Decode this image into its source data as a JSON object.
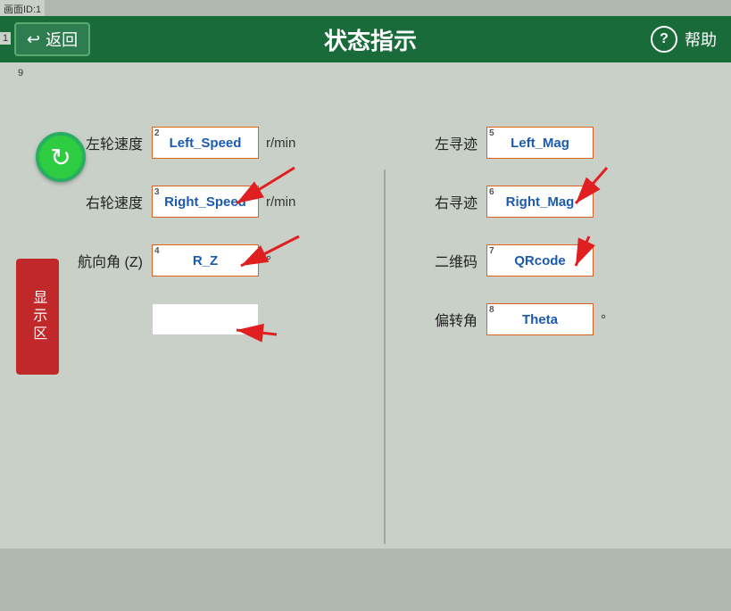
{
  "window": {
    "screen_id": "画面ID:1",
    "num_badge": "1"
  },
  "header": {
    "back_label": "返回",
    "title": "状态指示",
    "help_label": "帮助"
  },
  "clock_badge": "9",
  "left_section": {
    "rows": [
      {
        "num": "2",
        "label": "左轮速度",
        "value": "Left_Speed",
        "unit": "r/min"
      },
      {
        "num": "3",
        "label": "右轮速度",
        "value": "Right_Speed",
        "unit": "r/min"
      },
      {
        "num": "4",
        "label": "航向角 (Z)",
        "value": "R_Z",
        "unit": "°"
      },
      {
        "num": "",
        "label": "",
        "value": "",
        "unit": "",
        "empty": true
      }
    ]
  },
  "right_section": {
    "rows": [
      {
        "num": "5",
        "label": "左寻迹",
        "value": "Left_Mag",
        "unit": ""
      },
      {
        "num": "6",
        "label": "右寻迹",
        "value": "Right_Mag",
        "unit": ""
      },
      {
        "num": "7",
        "label": "二维码",
        "value": "QRcode",
        "unit": ""
      },
      {
        "num": "8",
        "label": "偏转角",
        "value": "Theta",
        "unit": "°"
      }
    ]
  },
  "display_zone_label": "显示区",
  "colors": {
    "header_bg": "#1a6b3a",
    "accent_green": "#27ae60",
    "accent_red": "#c0282a",
    "value_text": "#1a5ab0",
    "border_orange": "#e06020"
  }
}
